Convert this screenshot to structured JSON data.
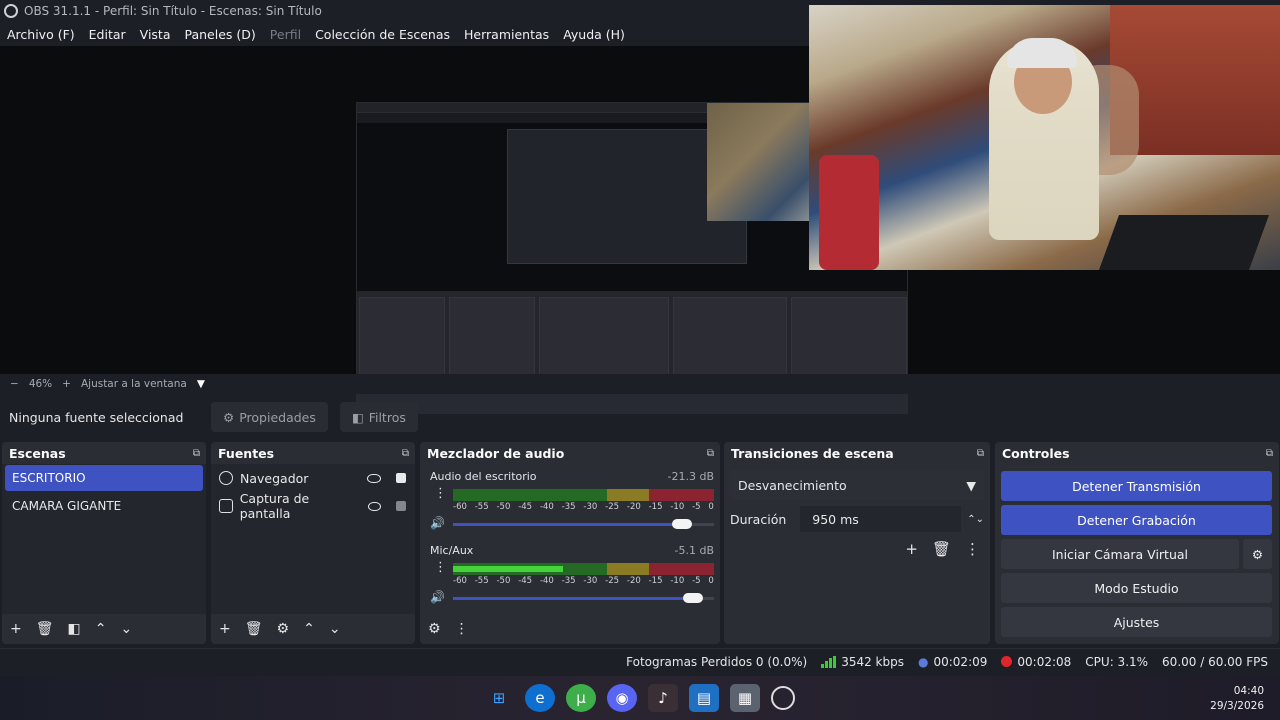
{
  "window": {
    "title": "OBS 31.1.1 - Perfil: Sin Título - Escenas: Sin Título"
  },
  "menu": [
    "Archivo (F)",
    "Editar",
    "Vista",
    "Paneles (D)",
    "Perfil",
    "Colección de Escenas",
    "Herramientas",
    "Ayuda (H)"
  ],
  "zoom": {
    "minus": "−",
    "value": "46%",
    "plus": "+",
    "fit": "Ajustar a la ventana",
    "arrow": "▼"
  },
  "source_bar": {
    "no_source": "Ninguna fuente seleccionad",
    "properties": "Propiedades",
    "filters": "Filtros"
  },
  "scenes": {
    "title": "Escenas",
    "items": [
      "ESCRITORIO",
      "CAMARA GIGANTE"
    ],
    "selected": 0
  },
  "sources": {
    "title": "Fuentes",
    "items": [
      {
        "name": "Navegador",
        "icon": "globe-icon"
      },
      {
        "name": "Captura de pantalla",
        "icon": "monitor-icon"
      }
    ]
  },
  "mixer": {
    "title": "Mezclador de audio",
    "channels": [
      {
        "name": "Audio del escritorio",
        "db": "-21.3 dB",
        "level": 0,
        "volume": 0.9
      },
      {
        "name": "Mic/Aux",
        "db": "-5.1 dB",
        "level": 0.42,
        "volume": 0.92
      }
    ],
    "ticks": [
      "-60",
      "-55",
      "-50",
      "-45",
      "-40",
      "-35",
      "-30",
      "-25",
      "-20",
      "-15",
      "-10",
      "-5",
      "0"
    ]
  },
  "transitions": {
    "title": "Transiciones de escena",
    "type": "Desvanecimiento",
    "duration_label": "Duración",
    "duration_value": "950 ms"
  },
  "controls": {
    "title": "Controles",
    "stop_stream": "Detener Transmisión",
    "stop_record": "Detener Grabación",
    "virtual_cam": "Iniciar Cámara Virtual",
    "studio_mode": "Modo Estudio",
    "settings": "Ajustes"
  },
  "status": {
    "dropped": "Fotogramas Perdidos 0 (0.0%)",
    "bitrate": "3542 kbps",
    "stream_time": "00:02:09",
    "rec_time": "00:02:08",
    "cpu": "CPU: 3.1%",
    "fps": "60.00 / 60.00 FPS"
  },
  "clock": {
    "time": "04:40",
    "date": "29/3/2026"
  },
  "colors": {
    "accent": "#3e52c2",
    "panel": "#2b2d35",
    "record": "#e0262d"
  }
}
